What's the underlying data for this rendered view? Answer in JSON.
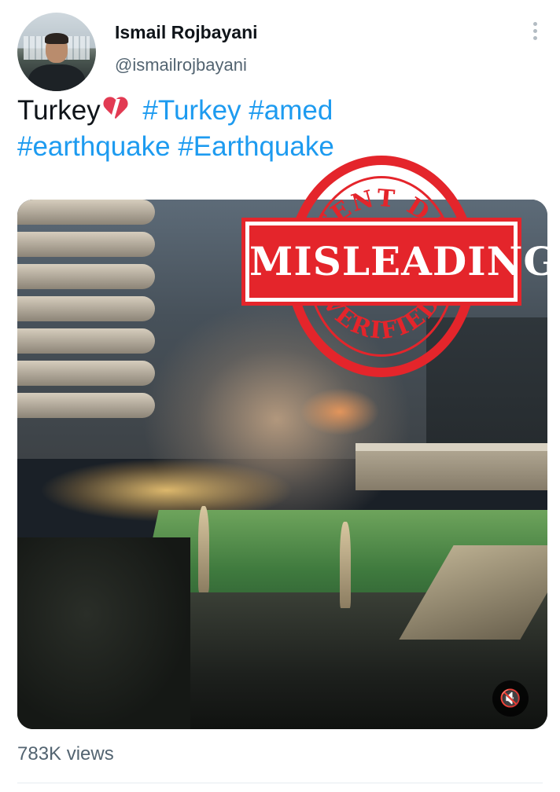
{
  "author": {
    "name": "Ismail Rojbayani",
    "handle": "@ismailrojbayani"
  },
  "tweet": {
    "text": "Turkey",
    "emoji_icon": "broken-heart-icon",
    "hashtags": [
      "#Turkey",
      "#amed",
      "#earthquake",
      "#Earthquake"
    ]
  },
  "media": {
    "type": "video",
    "mute_icon": "mute-icon",
    "mute_glyph": "🔇"
  },
  "stamp": {
    "top_text": "INTENT DATA",
    "main_text": "MISLEADING",
    "bottom_text": "VERIFIED",
    "color": "#e4252b"
  },
  "stats": {
    "views": "783K views"
  },
  "colors": {
    "link": "#1d9bf0",
    "secondary_text": "#536471"
  }
}
